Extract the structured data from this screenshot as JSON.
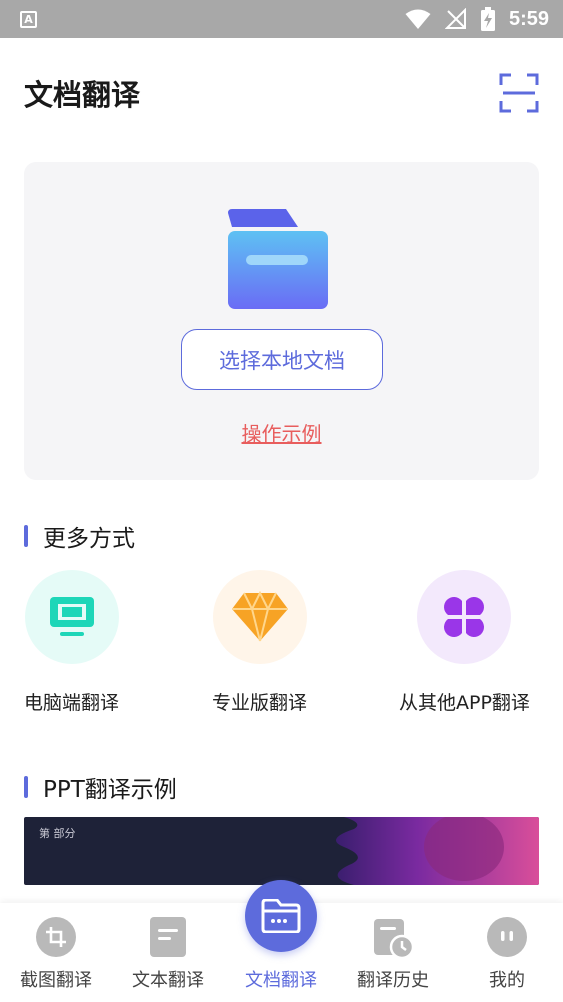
{
  "status_bar": {
    "badge": "A",
    "time": "5:59"
  },
  "header": {
    "title": "文档翻译"
  },
  "upload": {
    "select_label": "选择本地文档",
    "example_label": "操作示例"
  },
  "more": {
    "title": "更多方式",
    "items": [
      {
        "label": "电脑端翻译",
        "icon": "monitor-icon"
      },
      {
        "label": "专业版翻译",
        "icon": "diamond-icon"
      },
      {
        "label": "从其他APP翻译",
        "icon": "apps-grid-icon"
      }
    ]
  },
  "ppt": {
    "title": "PPT翻译示例",
    "banner_text": "第 部分"
  },
  "tabs": [
    {
      "label": "截图翻译",
      "icon": "crop-icon"
    },
    {
      "label": "文本翻译",
      "icon": "text-doc-icon"
    },
    {
      "label": "文档翻译",
      "icon": "folder-icon"
    },
    {
      "label": "翻译历史",
      "icon": "history-icon"
    },
    {
      "label": "我的",
      "icon": "profile-icon"
    }
  ],
  "colors": {
    "accent": "#5d6bdc",
    "link": "#e85d5d",
    "monitor": "#1ed6b8",
    "diamond": "#f7a325",
    "apps": "#9a36e8"
  }
}
